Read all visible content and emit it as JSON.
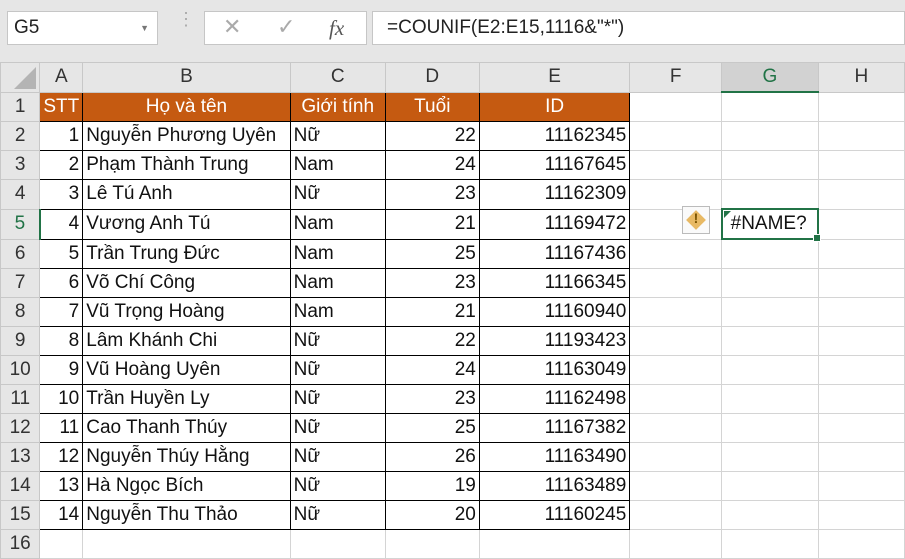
{
  "name_box": "G5",
  "formula_bar": {
    "cancel_icon": "✕",
    "enter_icon": "✓",
    "fx_label": "fx",
    "formula": "=COUNIF(E2:E15,1116&\"*\")"
  },
  "columns": [
    "A",
    "B",
    "C",
    "D",
    "E",
    "F",
    "G",
    "H"
  ],
  "header_row": {
    "stt": "STT",
    "name": "Họ và tên",
    "gender": "Giới tính",
    "age": "Tuổi",
    "id": "ID"
  },
  "rows": [
    [
      "1",
      "Nguyễn Phương Uyên",
      "Nữ",
      "22",
      "11162345"
    ],
    [
      "2",
      "Phạm Thành Trung",
      "Nam",
      "24",
      "11167645"
    ],
    [
      "3",
      "Lê Tú Anh",
      "Nữ",
      "23",
      "11162309"
    ],
    [
      "4",
      "Vương Anh Tú",
      "Nam",
      "21",
      "11169472"
    ],
    [
      "5",
      "Trần Trung Đức",
      "Nam",
      "25",
      "11167436"
    ],
    [
      "6",
      "Võ Chí Công",
      "Nam",
      "23",
      "11166345"
    ],
    [
      "7",
      "Vũ Trọng Hoàng",
      "Nam",
      "21",
      "11160940"
    ],
    [
      "8",
      "Lâm Khánh Chi",
      "Nữ",
      "22",
      "11193423"
    ],
    [
      "9",
      "Vũ Hoàng Uyên",
      "Nữ",
      "24",
      "11163049"
    ],
    [
      "10",
      "Trần Huyền Ly",
      "Nữ",
      "23",
      "11162498"
    ],
    [
      "11",
      "Cao Thanh Thúy",
      "Nữ",
      "25",
      "11167382"
    ],
    [
      "12",
      "Nguyễn Thúy Hằng",
      "Nữ",
      "26",
      "11163490"
    ],
    [
      "13",
      "Hà Ngọc Bích",
      "Nữ",
      "19",
      "11163489"
    ],
    [
      "14",
      "Nguyễn Thu Thảo",
      "Nữ",
      "20",
      "11160245"
    ]
  ],
  "g5_value": "#NAME?",
  "warning_icon": "!",
  "colors": {
    "header": "#C55A11",
    "selection": "#217346"
  }
}
